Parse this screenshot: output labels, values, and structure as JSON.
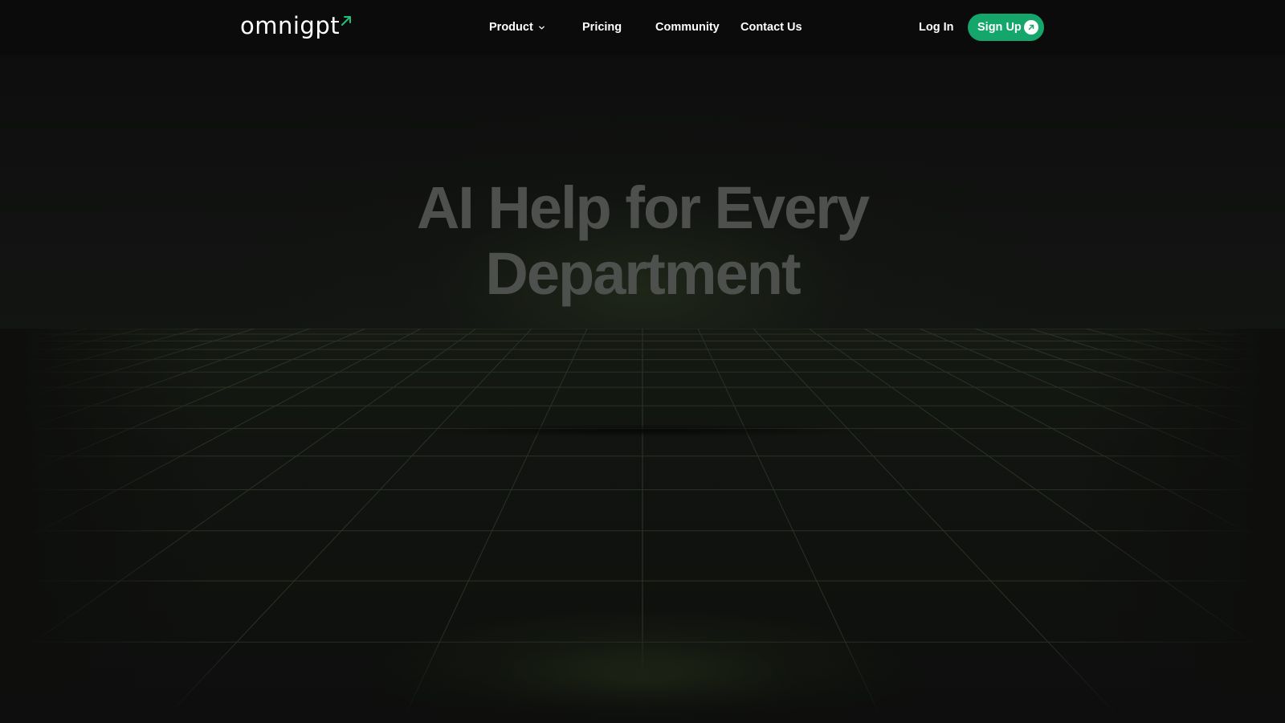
{
  "nav": {
    "logo_text": "omnigpt",
    "links": [
      {
        "label": "Product",
        "has_dropdown": true
      },
      {
        "label": "Pricing",
        "has_dropdown": false
      },
      {
        "label": "Community",
        "has_dropdown": false
      },
      {
        "label": "Contact Us",
        "has_dropdown": false
      }
    ],
    "login_label": "Log In",
    "signup_label": "Sign Up",
    "icons": {
      "logo_arrow": "arrow-up-right-icon",
      "dropdown": "chevron-down-icon",
      "signup": "arrow-up-right-circle-icon"
    }
  },
  "hero": {
    "title_line1": "AI Help for Every",
    "title_line2": "Department"
  },
  "colors": {
    "accent": "#15a66c",
    "logo_arrow": "#1ec27a",
    "background": "#0d0e0d",
    "hero_text": "#4e504e",
    "grid_line": "#2a3326"
  }
}
